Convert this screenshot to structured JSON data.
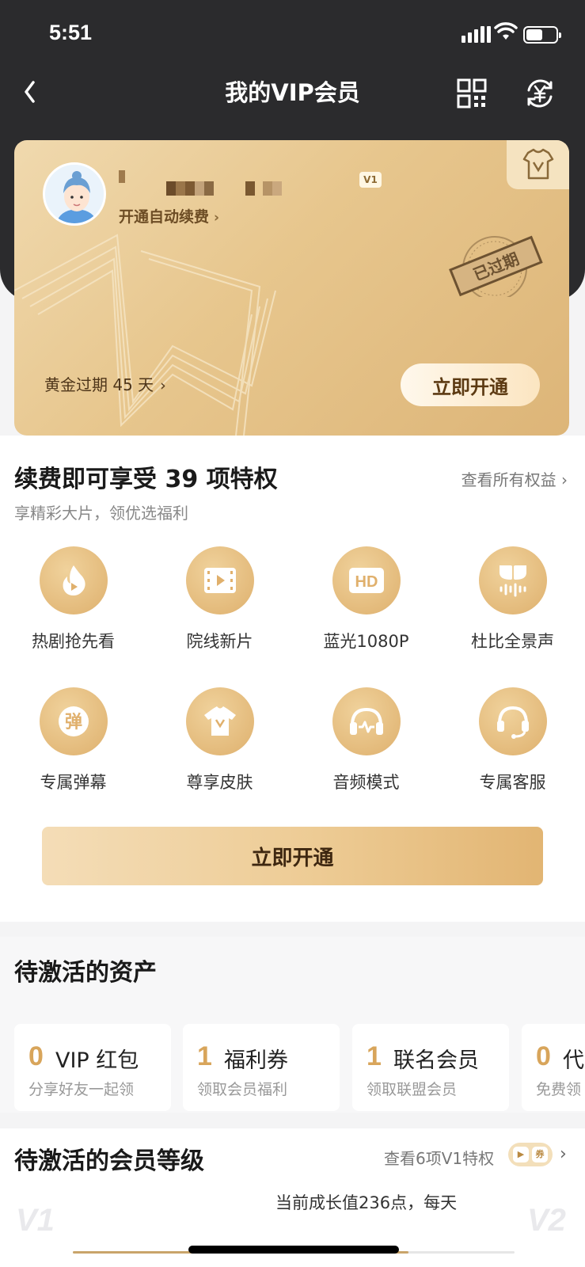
{
  "status_bar": {
    "time": "5:51",
    "battery_level": 0.55
  },
  "header": {
    "title": "我的VIP会员"
  },
  "vip_card": {
    "badge": "V1",
    "auto_renew_label": "开通自动续费",
    "stamp_text": "已过期",
    "expired_text": "黄金过期 45 天",
    "open_button": "立即开通",
    "colors": {
      "gold_light": "#f0d9ae",
      "gold_dark": "#ddb578"
    }
  },
  "privileges": {
    "title": "续费即可享受 39 项特权",
    "link": "查看所有权益",
    "subtitle": "享精彩大片，领优选福利",
    "items": [
      {
        "label": "热剧抢先看",
        "icon": "fire-play-icon"
      },
      {
        "label": "院线新片",
        "icon": "film-icon"
      },
      {
        "label": "蓝光1080P",
        "icon": "hd-icon"
      },
      {
        "label": "杜比全景声",
        "icon": "dolby-icon"
      },
      {
        "label": "专属弹幕",
        "icon": "danmaku-icon"
      },
      {
        "label": "尊享皮肤",
        "icon": "tshirt-icon"
      },
      {
        "label": "音频模式",
        "icon": "headphones-icon"
      },
      {
        "label": "专属客服",
        "icon": "headset-icon"
      }
    ],
    "open_button": "立即开通"
  },
  "assets": {
    "title": "待激活的资产",
    "items": [
      {
        "count": "0",
        "name": "VIP 红包",
        "desc": "分享好友一起领"
      },
      {
        "count": "1",
        "name": "福利券",
        "desc": "领取会员福利"
      },
      {
        "count": "1",
        "name": "联名会员",
        "desc": "领取联盟会员"
      },
      {
        "count": "0",
        "name": "代",
        "desc": "免费领"
      }
    ]
  },
  "levels": {
    "title": "待激活的会员等级",
    "link": "查看6项V1特权",
    "growth_text": "当前成长值236点，每天",
    "current_level": "V1",
    "next_level": "V2",
    "progress": 0.76
  }
}
